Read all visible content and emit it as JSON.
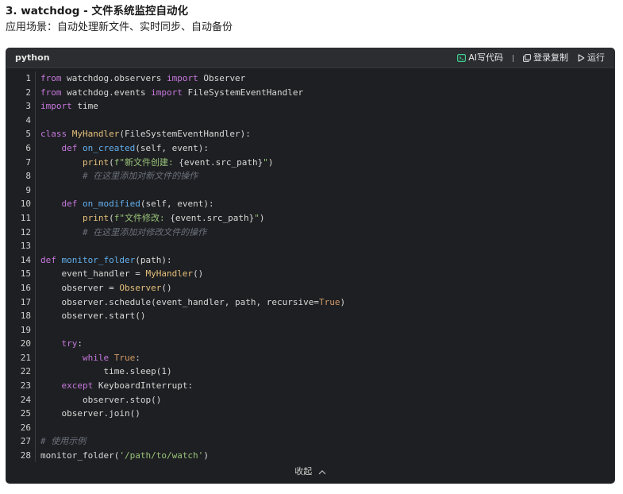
{
  "section": {
    "title": "3. watchdog - 文件系统监控自动化",
    "scenario": "应用场景：自动处理新文件、实时同步、自动备份"
  },
  "code_block": {
    "language": "python",
    "actions": {
      "ai_code": "AI写代码",
      "copy": "登录复制",
      "run": "运行"
    },
    "collapse_label": "收起",
    "line_numbers": [
      "1",
      "2",
      "3",
      "4",
      "5",
      "6",
      "7",
      "8",
      "9",
      "10",
      "11",
      "12",
      "13",
      "14",
      "15",
      "16",
      "17",
      "18",
      "19",
      "20",
      "21",
      "22",
      "23",
      "24",
      "25",
      "26",
      "27",
      "28"
    ],
    "lines": [
      [
        {
          "t": "from",
          "c": "kw"
        },
        {
          "t": " watchdog.observers ",
          "c": ""
        },
        {
          "t": "import",
          "c": "kw"
        },
        {
          "t": " Observer",
          "c": ""
        }
      ],
      [
        {
          "t": "from",
          "c": "kw"
        },
        {
          "t": " watchdog.events ",
          "c": ""
        },
        {
          "t": "import",
          "c": "kw"
        },
        {
          "t": " FileSystemEventHandler",
          "c": ""
        }
      ],
      [
        {
          "t": "import",
          "c": "kw"
        },
        {
          "t": " time",
          "c": ""
        }
      ],
      [],
      [
        {
          "t": "class",
          "c": "kw"
        },
        {
          "t": " MyHandler",
          "c": "cls"
        },
        {
          "t": "(FileSystemEventHandler):",
          "c": ""
        }
      ],
      [
        {
          "t": "    ",
          "c": ""
        },
        {
          "t": "def",
          "c": "kw"
        },
        {
          "t": " ",
          "c": ""
        },
        {
          "t": "on_created",
          "c": "fn"
        },
        {
          "t": "(self, event):",
          "c": ""
        }
      ],
      [
        {
          "t": "        ",
          "c": ""
        },
        {
          "t": "print",
          "c": "bi"
        },
        {
          "t": "(",
          "c": ""
        },
        {
          "t": "f\"新文件创建: ",
          "c": "str"
        },
        {
          "t": "{event.src_path}",
          "c": ""
        },
        {
          "t": "\"",
          "c": "str"
        },
        {
          "t": ")",
          "c": ""
        }
      ],
      [
        {
          "t": "        ",
          "c": ""
        },
        {
          "t": "# 在这里添加对新文件的操作",
          "c": "cm"
        }
      ],
      [],
      [
        {
          "t": "    ",
          "c": ""
        },
        {
          "t": "def",
          "c": "kw"
        },
        {
          "t": " ",
          "c": ""
        },
        {
          "t": "on_modified",
          "c": "fn"
        },
        {
          "t": "(self, event):",
          "c": ""
        }
      ],
      [
        {
          "t": "        ",
          "c": ""
        },
        {
          "t": "print",
          "c": "bi"
        },
        {
          "t": "(",
          "c": ""
        },
        {
          "t": "f\"文件修改: ",
          "c": "str"
        },
        {
          "t": "{event.src_path}",
          "c": ""
        },
        {
          "t": "\"",
          "c": "str"
        },
        {
          "t": ")",
          "c": ""
        }
      ],
      [
        {
          "t": "        ",
          "c": ""
        },
        {
          "t": "# 在这里添加对修改文件的操作",
          "c": "cm"
        }
      ],
      [],
      [
        {
          "t": "def",
          "c": "kw"
        },
        {
          "t": " ",
          "c": ""
        },
        {
          "t": "monitor_folder",
          "c": "fn"
        },
        {
          "t": "(path):",
          "c": ""
        }
      ],
      [
        {
          "t": "    event_handler = ",
          "c": ""
        },
        {
          "t": "MyHandler",
          "c": "cls"
        },
        {
          "t": "()",
          "c": ""
        }
      ],
      [
        {
          "t": "    observer = ",
          "c": ""
        },
        {
          "t": "Observer",
          "c": "cls"
        },
        {
          "t": "()",
          "c": ""
        }
      ],
      [
        {
          "t": "    observer.schedule(event_handler, path, recursive=",
          "c": ""
        },
        {
          "t": "True",
          "c": "const"
        },
        {
          "t": ")",
          "c": ""
        }
      ],
      [
        {
          "t": "    observer.start()",
          "c": ""
        }
      ],
      [],
      [
        {
          "t": "    ",
          "c": ""
        },
        {
          "t": "try",
          "c": "kw"
        },
        {
          "t": ":",
          "c": ""
        }
      ],
      [
        {
          "t": "        ",
          "c": ""
        },
        {
          "t": "while",
          "c": "kw"
        },
        {
          "t": " ",
          "c": ""
        },
        {
          "t": "True",
          "c": "const"
        },
        {
          "t": ":",
          "c": ""
        }
      ],
      [
        {
          "t": "            time.sleep(1)",
          "c": ""
        }
      ],
      [
        {
          "t": "    ",
          "c": ""
        },
        {
          "t": "except",
          "c": "kw"
        },
        {
          "t": " KeyboardInterrupt:",
          "c": ""
        }
      ],
      [
        {
          "t": "        observer.stop()",
          "c": ""
        }
      ],
      [
        {
          "t": "    observer.join()",
          "c": ""
        }
      ],
      [],
      [
        {
          "t": "# 使用示例",
          "c": "cm"
        }
      ],
      [
        {
          "t": "monitor_folder(",
          "c": ""
        },
        {
          "t": "'/path/to/watch'",
          "c": "str"
        },
        {
          "t": ")",
          "c": ""
        }
      ]
    ]
  },
  "colors": {
    "code_bg": "#1e1f22",
    "header_bg": "#2b2d31",
    "keyword": "#c678dd",
    "function": "#61afef",
    "string": "#98c379",
    "comment": "#6b717d",
    "constant": "#d19a66"
  },
  "icons": {
    "ai": "ai-code-icon",
    "copy": "copy-icon",
    "run": "run-triangle-icon",
    "collapse": "chevron-up-icon"
  }
}
